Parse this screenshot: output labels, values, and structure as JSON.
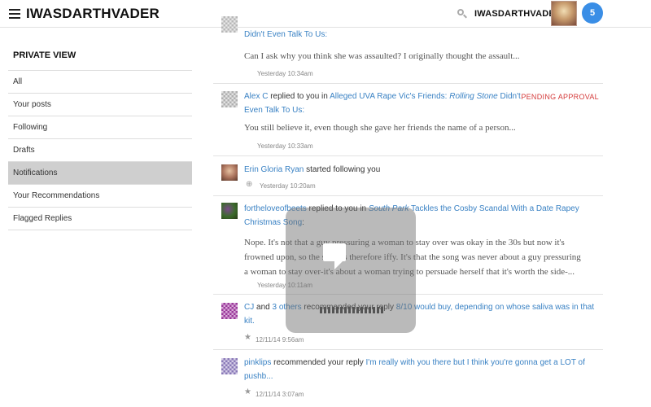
{
  "header": {
    "brand": "IWASDARTHVADER",
    "username": "IWASDARTHVADER",
    "notification_count": "5"
  },
  "sidebar": {
    "title": "PRIVATE VIEW",
    "items": [
      {
        "label": "All"
      },
      {
        "label": "Your posts"
      },
      {
        "label": "Following"
      },
      {
        "label": "Drafts"
      },
      {
        "label": "Notifications"
      },
      {
        "label": "Your Recommendations"
      },
      {
        "label": "Flagged Replies"
      }
    ]
  },
  "feed": {
    "item0": {
      "link": "Didn't Even Talk To Us:",
      "excerpt": "Can I ask why you think she was assaulted? I originally thought the assault...",
      "time": "Yesterday 10:34am"
    },
    "item1": {
      "user": "Alex C",
      "action": " replied to you in ",
      "article_pre": "Alleged UVA Rape Vic's Friends: ",
      "article_italic": "Rolling Stone",
      "article_post": " Didn't",
      "article_line2": "Even Talk To Us:",
      "status": "PENDING APPROVAL",
      "excerpt": "You still believe it, even though she gave her friends the name of a person...",
      "time": "Yesterday 10:33am"
    },
    "item2": {
      "user": "Erin Gloria Ryan",
      "action": " started following you",
      "time": "Yesterday 10:20am"
    },
    "item3": {
      "user": "fortheloveofbeets",
      "action": " replied to you in ",
      "article_italic": "South Park",
      "article_post": " Tackles the Cosby Scandal With a Date Rapey",
      "article_line2": "Christmas Song",
      "colon": ":",
      "excerpt_line1": "Nope. It's not that a guy pressuring a woman to stay over was okay in the 30s but now it's",
      "excerpt_line2": "frowned upon, so the song is therefore iffy. It's that the song was never about a guy pressuring",
      "excerpt_line3": "a woman to stay over-it's about a woman trying to persuade herself that it's worth the side-...",
      "time": "Yesterday 10:11am"
    },
    "item4": {
      "user": "CJ",
      "and": " and ",
      "others": "3 others",
      "action": " recommended your reply ",
      "reply": "8/10 would buy, depending on whose saliva was in that",
      "reply_line2": "kit.",
      "time": "12/11/14 9:56am"
    },
    "item5": {
      "user": "pinklips",
      "action": " recommended your reply ",
      "reply": "I'm really with you there but I think you're gonna get a LOT of",
      "reply_line2": "pushb...",
      "time": "12/11/14 3:07am"
    }
  }
}
